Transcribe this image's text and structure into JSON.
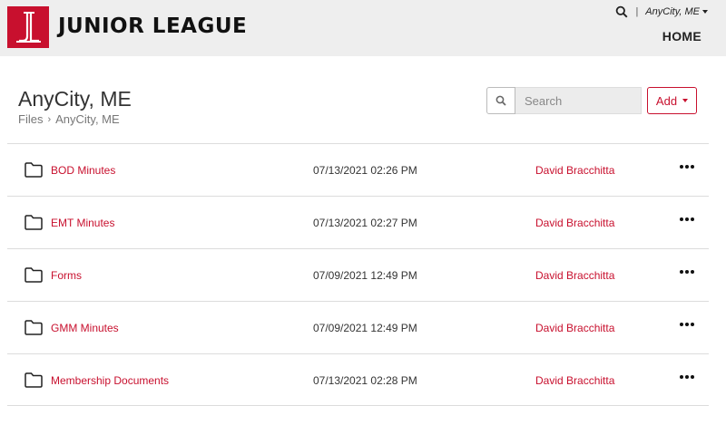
{
  "header": {
    "brand": "JUNIOR LEAGUE",
    "logo_letters": "JL",
    "separator": "|",
    "city_menu": "AnyCity, ME",
    "nav_home": "HOME"
  },
  "page": {
    "title": "AnyCity, ME",
    "breadcrumb": {
      "root": "Files",
      "current": "AnyCity, ME"
    }
  },
  "search": {
    "placeholder": "Search"
  },
  "actions": {
    "add_label": "Add"
  },
  "files": [
    {
      "name": "BOD Minutes",
      "date": "07/13/2021 02:26 PM",
      "owner": "David Bracchitta"
    },
    {
      "name": "EMT Minutes",
      "date": "07/13/2021 02:27 PM",
      "owner": "David Bracchitta"
    },
    {
      "name": "Forms",
      "date": "07/09/2021 12:49 PM",
      "owner": "David Bracchitta"
    },
    {
      "name": "GMM Minutes",
      "date": "07/09/2021 12:49 PM",
      "owner": "David Bracchitta"
    },
    {
      "name": "Membership Documents",
      "date": "07/13/2021 02:28 PM",
      "owner": "David Bracchitta"
    }
  ],
  "colors": {
    "accent": "#c8102e",
    "header_bg": "#eeeeee"
  },
  "icons": {
    "search": "search-icon",
    "folder": "folder-icon",
    "more": "more-options-icon"
  }
}
